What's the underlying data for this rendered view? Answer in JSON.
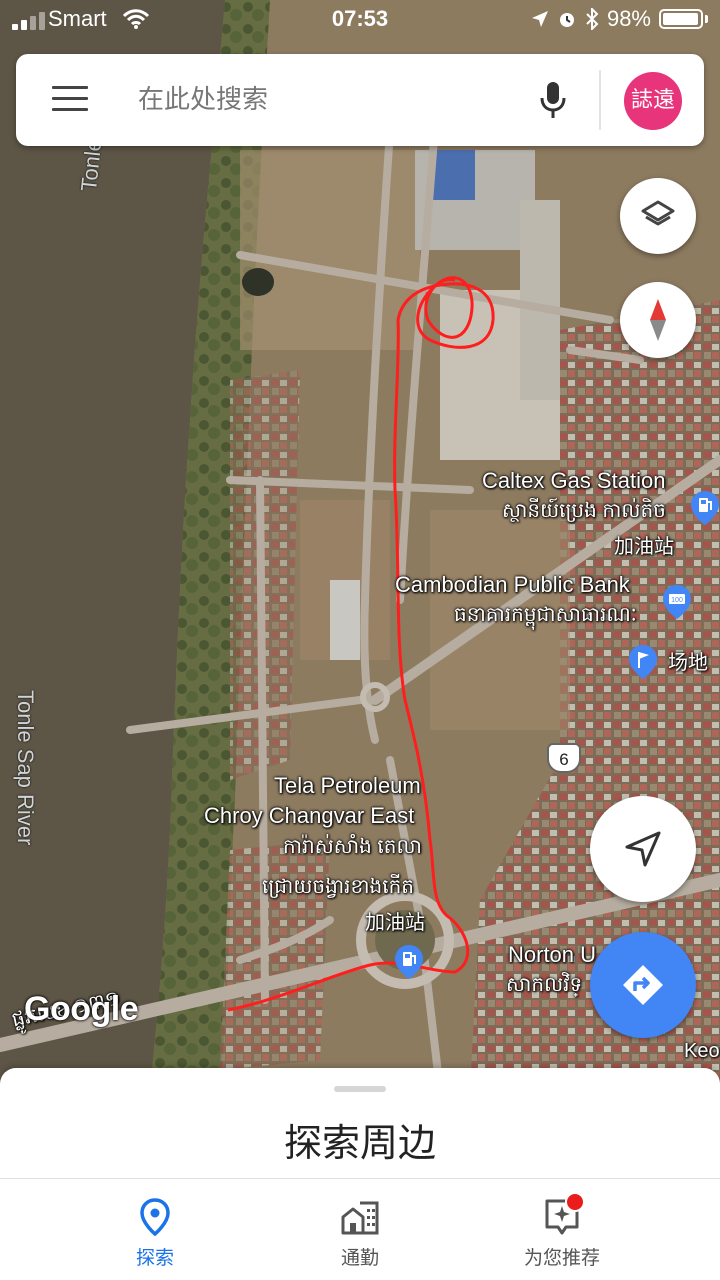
{
  "status_bar": {
    "carrier": "Smart",
    "time": "07:53",
    "battery": "98%"
  },
  "search": {
    "placeholder": "在此处搜索",
    "avatar_text": "誌遠"
  },
  "map": {
    "labels": {
      "river_top": "Tonle",
      "river_side": "Tonle Sap River",
      "caltex_en": "Caltex Gas Station",
      "caltex_km": "ស្ថានីយ៍ប្រេង កាល់តិច",
      "caltex_zh": "加油站",
      "cpb_en": "Cambodian Public Bank",
      "cpb_km": "ធនាគារកម្ពុជាសាធារណៈ",
      "venue_zh": "场地",
      "route_shield": "6",
      "tela_en_1": "Tela Petroleum",
      "tela_en_2": "Chroy Changvar East",
      "tela_km_1": "ការ៉ាស់សាំង តេលា",
      "tela_km_2": "ជ្រោយចង្វារខាងកើត",
      "tela_zh": "加油站",
      "norton_en": "Norton U",
      "norton_km": "សាកលវិទ្",
      "keo": "Keo",
      "street_bottom": "ផ្លូវលេខ ១៣១",
      "google": "Google"
    },
    "colors": {
      "river": "#5d5546",
      "land": "#8d7b60",
      "route": "#ff1e1e"
    }
  },
  "fabs": {
    "layers_icon": "layers-icon",
    "compass_icon": "compass-icon",
    "location_icon": "navigation-arrow-icon",
    "directions_icon": "directions-icon",
    "directions_color": "#4285f4"
  },
  "sheet": {
    "title": "探索周边"
  },
  "bottom_nav": {
    "items": [
      {
        "label": "探索",
        "icon": "location-pin-icon",
        "active": true
      },
      {
        "label": "通勤",
        "icon": "commute-buildings-icon",
        "active": false
      },
      {
        "label": "为您推荐",
        "icon": "sparkle-recommend-icon",
        "active": false
      }
    ],
    "active_color": "#1a73e8"
  }
}
